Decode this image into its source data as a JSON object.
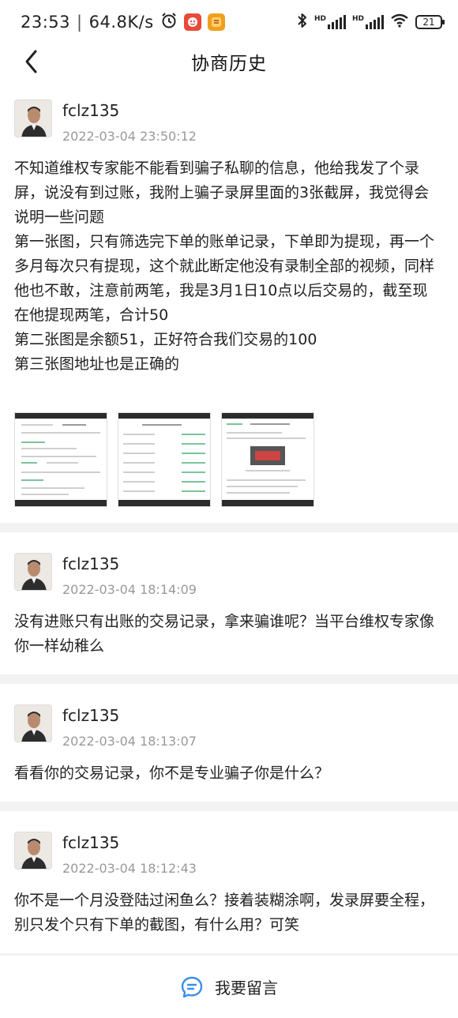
{
  "status_bar": {
    "time": "23:53",
    "speed": "64.8K/s",
    "battery": "21",
    "hd1": "HD",
    "hd2": "HD"
  },
  "nav": {
    "title": "协商历史"
  },
  "posts": [
    {
      "username": "fclz135",
      "time": "2022-03-04 23:50:12",
      "text": "不知道维权专家能不能看到骗子私聊的信息，他给我发了个录屏，说没有到过账，我附上骗子录屏里面的3张截屏，我觉得会说明一些问题\n第一张图，只有筛选完下单的账单记录，下单即为提现，再一个多月每次只有提现，这个就此断定他没有录制全部的视频，同样他也不敢，注意前两笔，我是3月1日10点以后交易的，截至现在他提现两笔，合计50\n第二张图是余额51，正好符合我们交易的100\n第三张图地址也是正确的"
    },
    {
      "username": "fclz135",
      "time": "2022-03-04 18:14:09",
      "text": "没有进账只有出账的交易记录，拿来骗谁呢？当平台维权专家像你一样幼稚么"
    },
    {
      "username": "fclz135",
      "time": "2022-03-04 18:13:07",
      "text": "看看你的交易记录，你不是专业骗子你是什么？"
    },
    {
      "username": "fclz135",
      "time": "2022-03-04 18:12:43",
      "text": "你不是一个月没登陆过闲鱼么？接着装糊涂啊，发录屏要全程，别只发个只有下单的截图，有什么用？可笑"
    },
    {
      "username": "fclz135"
    }
  ],
  "bottom_bar": {
    "label": "我要留言"
  },
  "colors": {
    "accent": "#3a8ee6",
    "background": "#f2f2f2",
    "secondary_text": "#999999"
  }
}
